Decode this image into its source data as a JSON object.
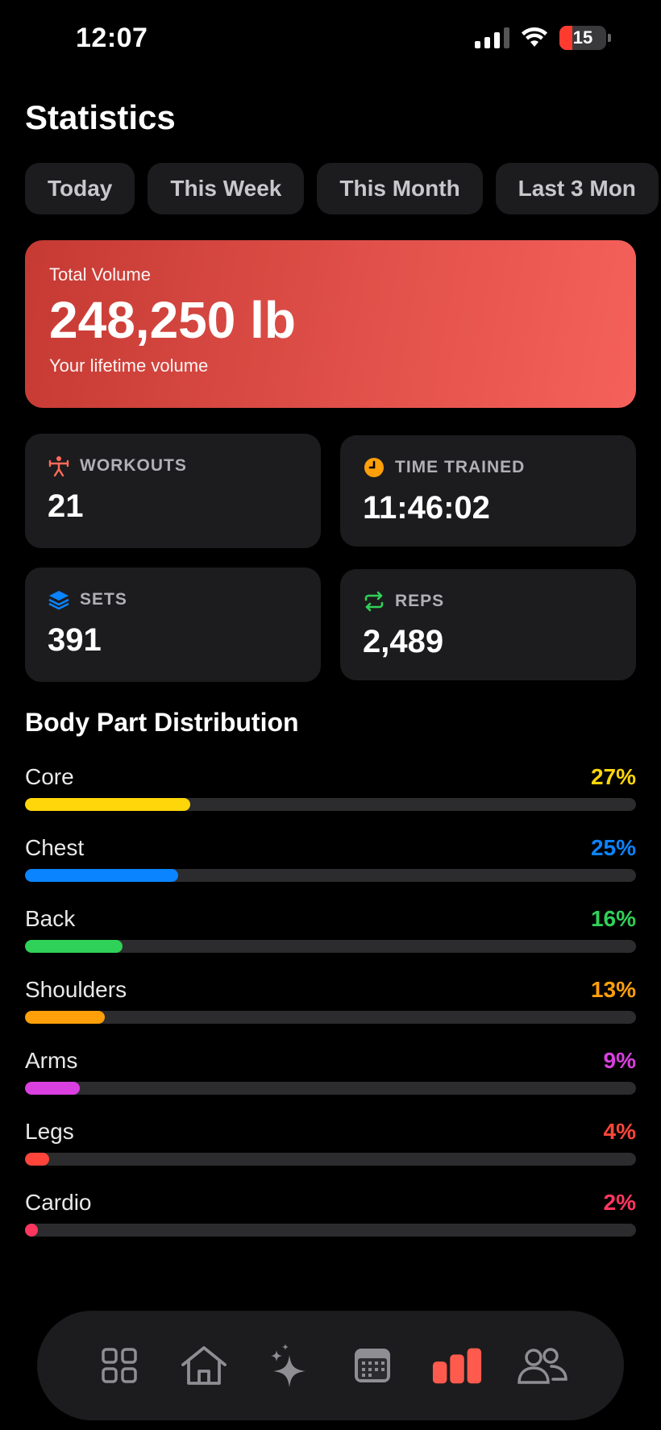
{
  "status_bar": {
    "time": "12:07",
    "battery": "15"
  },
  "page_title": "Statistics",
  "period_tabs": [
    "Today",
    "This Week",
    "This Month",
    "Last 3 Mon"
  ],
  "total_volume": {
    "label": "Total Volume",
    "value": "248,250 lb",
    "subtitle": "Your lifetime volume"
  },
  "stats": {
    "workouts": {
      "label": "WORKOUTS",
      "value": "21",
      "icon": "dumbbell-icon",
      "color": "#ff6b5a"
    },
    "time_trained": {
      "label": "TIME TRAINED",
      "value": "11:46:02",
      "icon": "clock-icon",
      "color": "#ff9f0a"
    },
    "sets": {
      "label": "SETS",
      "value": "391",
      "icon": "layers-icon",
      "color": "#0a84ff"
    },
    "reps": {
      "label": "REPS",
      "value": "2,489",
      "icon": "repeat-icon",
      "color": "#30d158"
    }
  },
  "distribution": {
    "title": "Body Part Distribution",
    "items": [
      {
        "name": "Core",
        "percent_label": "27%",
        "fraction": 0.27,
        "color": "#ffd60a"
      },
      {
        "name": "Chest",
        "percent_label": "25%",
        "fraction": 0.25,
        "color": "#0a84ff"
      },
      {
        "name": "Back",
        "percent_label": "16%",
        "fraction": 0.16,
        "color": "#30d158"
      },
      {
        "name": "Shoulders",
        "percent_label": "13%",
        "fraction": 0.13,
        "color": "#ff9f0a"
      },
      {
        "name": "Arms",
        "percent_label": "9%",
        "fraction": 0.09,
        "color": "#da3fe0"
      },
      {
        "name": "Legs",
        "percent_label": "4%",
        "fraction": 0.04,
        "color": "#ff453a"
      },
      {
        "name": "Cardio",
        "percent_label": "2%",
        "fraction": 0.02,
        "color": "#ff375f"
      }
    ]
  },
  "tab_bar": {
    "items": [
      "grid-icon",
      "home-icon",
      "sparkles-icon",
      "calendar-icon",
      "bar-chart-icon",
      "people-icon"
    ],
    "active": "bar-chart-icon",
    "active_color": "#ff5a4e"
  }
}
